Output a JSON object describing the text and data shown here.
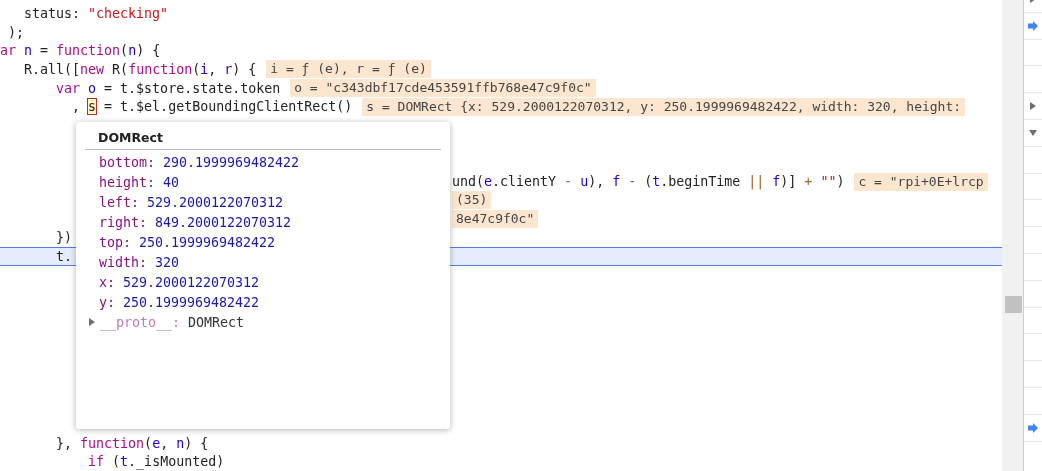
{
  "editor": {
    "lines": [
      {
        "kind": "code",
        "current": false,
        "code": [
          {
            "kind": "plain",
            "text": "   status: "
          },
          {
            "kind": "string",
            "text": "\"checking\""
          }
        ]
      },
      {
        "kind": "code",
        "current": false,
        "code": [
          {
            "kind": "plain",
            "text": " );"
          }
        ]
      },
      {
        "kind": "code",
        "current": false,
        "code": [
          {
            "kind": "keyword",
            "text": "ar"
          },
          {
            "kind": "variable",
            "text": " n"
          },
          {
            "kind": "plain",
            "text": " = "
          },
          {
            "kind": "keyword",
            "text": "function"
          },
          {
            "kind": "plain",
            "text": "("
          },
          {
            "kind": "variable",
            "text": "n"
          },
          {
            "kind": "plain",
            "text": ") {"
          }
        ]
      },
      {
        "kind": "code",
        "current": false,
        "code": [
          {
            "kind": "plain",
            "text": "   R.all(["
          },
          {
            "kind": "keyword",
            "text": "new"
          },
          {
            "kind": "plain",
            "text": " R("
          },
          {
            "kind": "keyword",
            "text": "function"
          },
          {
            "kind": "plain",
            "text": "("
          },
          {
            "kind": "variable",
            "text": "i"
          },
          {
            "kind": "plain",
            "text": ", "
          },
          {
            "kind": "variable",
            "text": "r"
          },
          {
            "kind": "plain",
            "text": ") {"
          }
        ],
        "value": "i = ƒ (e), r = ƒ (e)"
      },
      {
        "kind": "code",
        "current": false,
        "code": [
          {
            "kind": "keyword",
            "text": "       var"
          },
          {
            "kind": "variable",
            "text": " o"
          },
          {
            "kind": "plain",
            "text": " = t.$store.state.token"
          }
        ],
        "value": "o = \"c343dbf17cde453591ffb768e47c9f0c\""
      },
      {
        "kind": "code",
        "current": false,
        "code": [
          {
            "kind": "plain",
            "text": "         , "
          },
          {
            "kind": "hover",
            "text": "s"
          },
          {
            "kind": "plain",
            "text": " = t.$el.getBoundingClientRect()"
          }
        ],
        "value": "s = DOMRect {x: 529.2000122070312, y: 250.1999969482422, width: 320, height:"
      },
      {
        "kind": "blank",
        "current": false
      },
      {
        "kind": "blank",
        "current": false
      },
      {
        "kind": "blank",
        "current": false
      },
      {
        "kind": "covered",
        "current": false,
        "code": [
          {
            "kind": "plain",
            "text": "und("
          },
          {
            "kind": "variable",
            "text": "e"
          },
          {
            "kind": "plain",
            "text": ".clientY "
          },
          {
            "kind": "operator",
            "text": "-"
          },
          {
            "kind": "variable",
            "text": " u"
          },
          {
            "kind": "plain",
            "text": "), "
          },
          {
            "kind": "variable",
            "text": "f"
          },
          {
            "kind": "operator",
            "text": " -"
          },
          {
            "kind": "plain",
            "text": " ("
          },
          {
            "kind": "variable",
            "text": "t"
          },
          {
            "kind": "plain",
            "text": ".beginTime "
          },
          {
            "kind": "operator",
            "text": "||"
          },
          {
            "kind": "variable",
            "text": " f"
          },
          {
            "kind": "plain",
            "text": ")] "
          },
          {
            "kind": "operator",
            "text": "+"
          },
          {
            "kind": "string",
            "text": " \"\""
          },
          {
            "kind": "plain",
            "text": ")"
          }
        ],
        "value": "c = \"rpi+0E+lrcp"
      },
      {
        "kind": "covered",
        "current": false,
        "value": "(35)"
      },
      {
        "kind": "covered",
        "current": false,
        "value": "8e47c9f0c\""
      },
      {
        "kind": "code",
        "current": false,
        "code": [
          {
            "kind": "plain",
            "text": "       })"
          }
        ]
      },
      {
        "kind": "code",
        "current": true,
        "code": [
          {
            "kind": "plain",
            "text": "       t."
          }
        ]
      },
      {
        "kind": "blank",
        "current": false
      },
      {
        "kind": "blank",
        "current": false
      },
      {
        "kind": "blank",
        "current": false
      },
      {
        "kind": "blank",
        "current": false
      },
      {
        "kind": "blank",
        "current": false
      },
      {
        "kind": "blank",
        "current": false
      },
      {
        "kind": "blank",
        "current": false
      },
      {
        "kind": "blank",
        "current": false
      },
      {
        "kind": "blank",
        "current": false
      },
      {
        "kind": "code",
        "current": false,
        "code": [
          {
            "kind": "plain",
            "text": "       }, "
          },
          {
            "kind": "keyword",
            "text": "function"
          },
          {
            "kind": "plain",
            "text": "("
          },
          {
            "kind": "variable",
            "text": "e"
          },
          {
            "kind": "plain",
            "text": ", "
          },
          {
            "kind": "variable",
            "text": "n"
          },
          {
            "kind": "plain",
            "text": ") {"
          }
        ]
      },
      {
        "kind": "code",
        "current": false,
        "code": [
          {
            "kind": "keyword",
            "text": "           if"
          },
          {
            "kind": "plain",
            "text": " ("
          },
          {
            "kind": "variable",
            "text": "t"
          },
          {
            "kind": "plain",
            "text": "._isMounted)"
          }
        ]
      }
    ]
  },
  "popover": {
    "title": "DOMRect",
    "properties": [
      {
        "key": "bottom:",
        "value": "290.1999969482422"
      },
      {
        "key": "height:",
        "value": "40"
      },
      {
        "key": "left:",
        "value": "529.2000122070312"
      },
      {
        "key": "right:",
        "value": "849.2000122070312"
      },
      {
        "key": "top:",
        "value": "250.1999969482422"
      },
      {
        "key": "width:",
        "value": "320"
      },
      {
        "key": "x:",
        "value": "529.2000122070312"
      },
      {
        "key": "y:",
        "value": "250.1999969482422"
      }
    ],
    "proto": {
      "key": "__proto__:",
      "value": "DOMRect",
      "expanded": false
    }
  },
  "side_panel": {
    "rows": [
      {
        "kind": "expander",
        "expanded": false
      },
      {
        "kind": "marker"
      },
      {
        "kind": "blank"
      },
      {
        "kind": "blank"
      },
      {
        "kind": "expander",
        "expanded": false
      },
      {
        "kind": "expander",
        "expanded": true
      },
      {
        "kind": "blank"
      },
      {
        "kind": "blank"
      },
      {
        "kind": "blank"
      },
      {
        "kind": "blank"
      },
      {
        "kind": "blank"
      },
      {
        "kind": "blank"
      },
      {
        "kind": "blank"
      },
      {
        "kind": "blank"
      },
      {
        "kind": "blank"
      },
      {
        "kind": "blank"
      },
      {
        "kind": "marker"
      }
    ]
  }
}
